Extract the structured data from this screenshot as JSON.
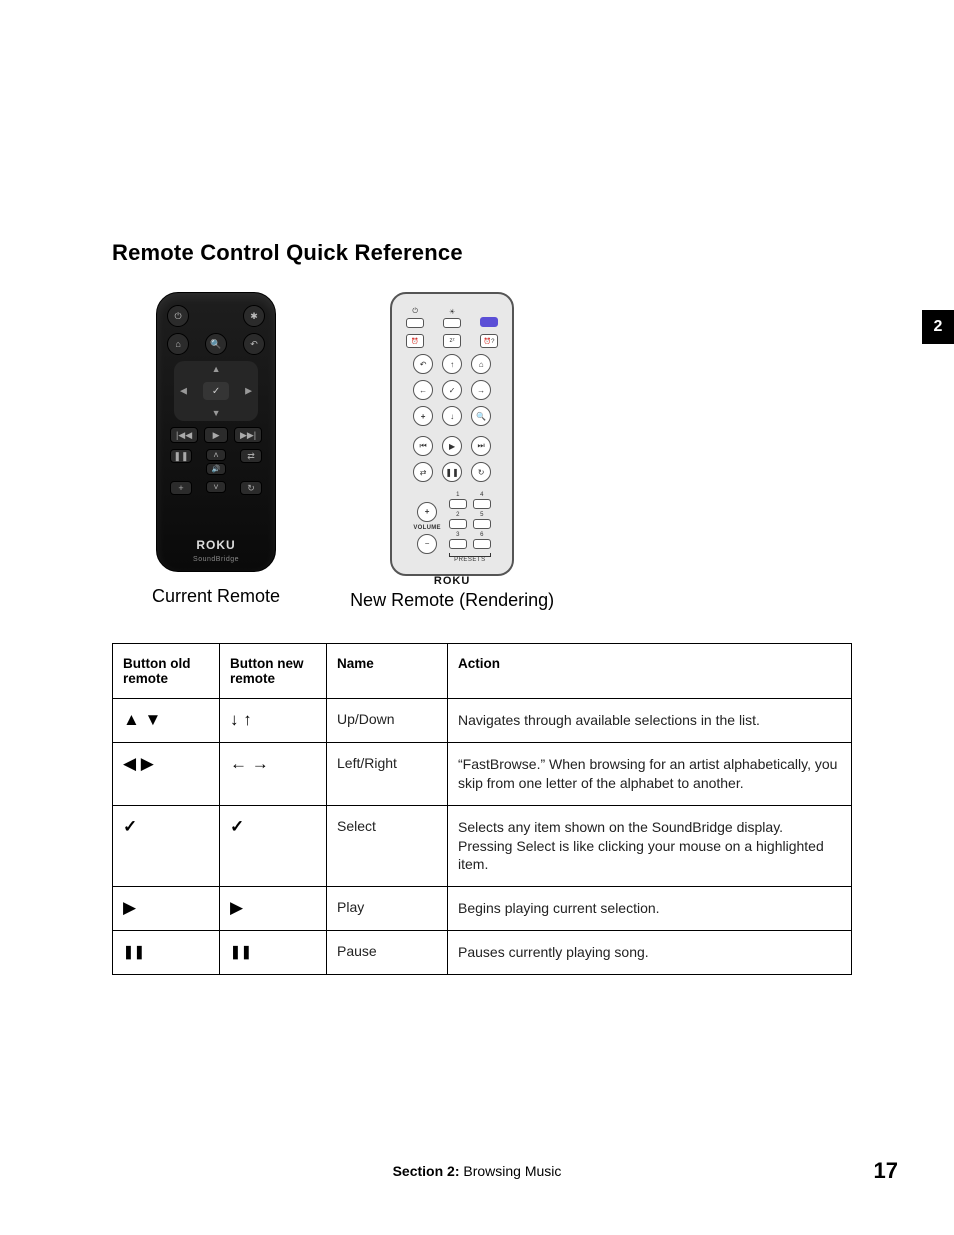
{
  "page": {
    "heading": "Remote Control Quick Reference",
    "section_tab": "2",
    "footer_section_label": "Section 2:",
    "footer_section_title": " Browsing Music",
    "page_number": "17"
  },
  "remotes": {
    "old_caption": "Current Remote",
    "new_caption": "New Remote (Rendering)",
    "brand": "ROKU",
    "old_subbrand": "SoundBridge",
    "new_volume_label": "VOLUME",
    "new_presets_label": "PRESETS"
  },
  "table": {
    "headers": {
      "old": "Button old remote",
      "new": "Button new remote",
      "name": "Name",
      "action": "Action"
    },
    "rows": [
      {
        "old_sym": "▲  ▼",
        "new_sym": "↓ ↑",
        "name": "Up/Down",
        "action": "Navigates through available selections in the list."
      },
      {
        "old_sym": "◀  ▶",
        "new_sym": "← →",
        "name": "Left/Right",
        "action": "“FastBrowse.” When browsing for an artist alphabetically, you skip from one letter of the alphabet to another."
      },
      {
        "old_sym": "✓",
        "new_sym": "✓",
        "name": "Select",
        "action": "Selects any item shown on the SoundBridge display. Pressing Select is like clicking your mouse on a highlighted item."
      },
      {
        "old_sym": "▶",
        "new_sym": "▶",
        "name": "Play",
        "action": "Begins playing current selection."
      },
      {
        "old_sym": "❚❚",
        "new_sym": "❚❚",
        "name": "Pause",
        "action": "Pauses currently playing song."
      }
    ]
  }
}
